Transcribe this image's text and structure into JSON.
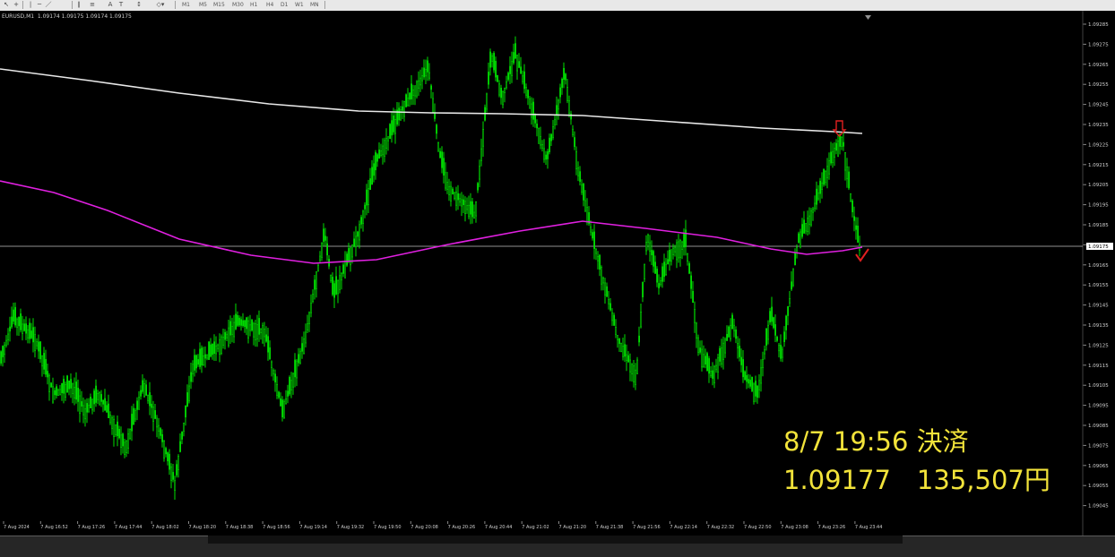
{
  "toolbar": {
    "timeframes": [
      "M1",
      "M5",
      "M15",
      "M30",
      "H1",
      "H4",
      "D1",
      "W1",
      "MN"
    ]
  },
  "chart": {
    "symbol_line": "EURUSD,M1  1.09174 1.09175 1.09174 1.09175",
    "price_axis": [
      "1.09285",
      "1.09275",
      "1.09265",
      "1.09255",
      "1.09245",
      "1.09235",
      "1.09225",
      "1.09215",
      "1.09205",
      "1.09195",
      "1.09185",
      "1.09175",
      "1.09165",
      "1.09155",
      "1.09145",
      "1.09135",
      "1.09125",
      "1.09115",
      "1.09105",
      "1.09095",
      "1.09085",
      "1.09075",
      "1.09065",
      "1.09055",
      "1.09045"
    ],
    "current_price_tag": "1.09175",
    "time_axis": [
      "7 Aug 2024",
      "7 Aug 16:52",
      "7 Aug 17:26",
      "7 Aug 17:44",
      "7 Aug 18:02",
      "7 Aug 18:20",
      "7 Aug 18:38",
      "7 Aug 18:56",
      "7 Aug 19:14",
      "7 Aug 19:32",
      "7 Aug 19:50",
      "7 Aug 20:08",
      "7 Aug 20:26",
      "7 Aug 20:44",
      "7 Aug 21:02",
      "7 Aug 21:20",
      "7 Aug 21:38",
      "7 Aug 21:56",
      "7 Aug 22:14",
      "7 Aug 22:32",
      "7 Aug 22:50",
      "7 Aug 23:08",
      "7 Aug 23:26",
      "7 Aug 23:44"
    ],
    "colors": {
      "background": "#000000",
      "candles": "#00e000",
      "slow_ma": "#e8e8e8",
      "fast_ma": "#e020e0",
      "arrow": "#e02020",
      "price_line": "#c0c0c0"
    }
  },
  "annotation": {
    "line1": "8/7 19:56 決済",
    "line2": "1.09177　135,507円"
  }
}
